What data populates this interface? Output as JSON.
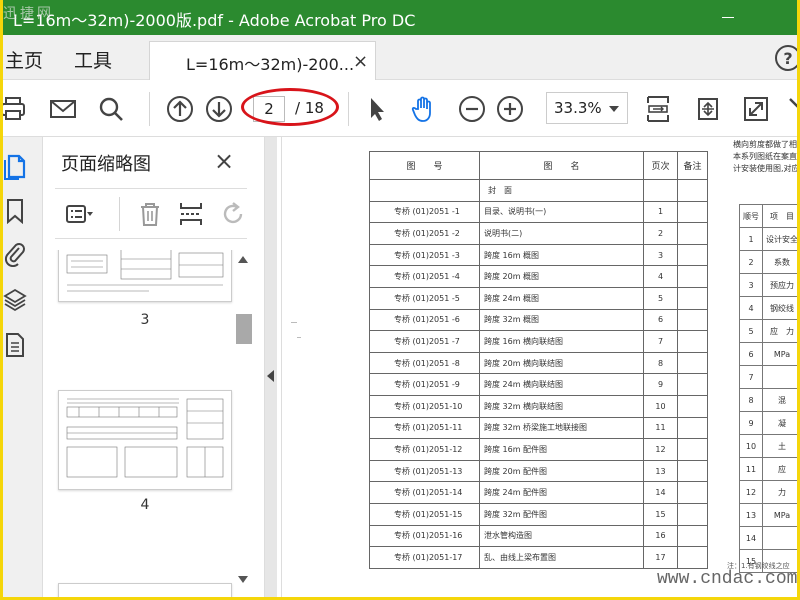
{
  "window": {
    "title": "L=16m～32m)-2000版.pdf - Adobe Acrobat Pro DC",
    "watermark": "迅捷网"
  },
  "menu": {
    "home": "主页",
    "tools": "工具",
    "doc_tab": "L=16m～32m)-200...",
    "doc_tab_close": "×",
    "help": "?"
  },
  "toolbar": {
    "current_page": "2",
    "total_pages": "/ 18",
    "zoom": "33.3%"
  },
  "thumbnails_panel": {
    "title": "页面缩略图",
    "close": "×",
    "pages": [
      {
        "label": "3"
      },
      {
        "label": "4"
      }
    ]
  },
  "document": {
    "table_header": {
      "no": "图　　号",
      "name": "图　　名",
      "pages": "页次",
      "remarks": "备注"
    },
    "rows": [
      {
        "no": "",
        "name": "封　面",
        "page": ""
      },
      {
        "no": "专桥 (01)2051 -1",
        "name": "目录、说明书(一)",
        "page": "1"
      },
      {
        "no": "专桥 (01)2051 -2",
        "name": "说明书(二)",
        "page": "2"
      },
      {
        "no": "专桥 (01)2051 -3",
        "name": "跨度 16m 概图",
        "page": "3"
      },
      {
        "no": "专桥 (01)2051 -4",
        "name": "跨度 20m 概图",
        "page": "4"
      },
      {
        "no": "专桥 (01)2051 -5",
        "name": "跨度 24m 概图",
        "page": "5"
      },
      {
        "no": "专桥 (01)2051 -6",
        "name": "跨度 32m 概图",
        "page": "6"
      },
      {
        "no": "专桥 (01)2051 -7",
        "name": "跨度 16m 横向联结图",
        "page": "7"
      },
      {
        "no": "专桥 (01)2051 -8",
        "name": "跨度 20m 横向联结图",
        "page": "8"
      },
      {
        "no": "专桥 (01)2051 -9",
        "name": "跨度 24m 横向联结图",
        "page": "9"
      },
      {
        "no": "专桥 (01)2051-10",
        "name": "跨度 32m 横向联结图",
        "page": "10"
      },
      {
        "no": "专桥 (01)2051-11",
        "name": "跨度 32m 桥梁施工地联接图",
        "page": "11"
      },
      {
        "no": "专桥 (01)2051-12",
        "name": "跨度 16m 配件图",
        "page": "12"
      },
      {
        "no": "专桥 (01)2051-13",
        "name": "跨度 20m 配件图",
        "page": "13"
      },
      {
        "no": "专桥 (01)2051-14",
        "name": "跨度 24m 配件图",
        "page": "14"
      },
      {
        "no": "专桥 (01)2051-15",
        "name": "跨度 32m 配件图",
        "page": "15"
      },
      {
        "no": "专桥 (01)2051-16",
        "name": "泄水管构造图",
        "page": "16"
      },
      {
        "no": "专桥 (01)2051-17",
        "name": "乱、由线上梁布置图",
        "page": "17"
      }
    ],
    "side_text": [
      "横向剪度都做了相应",
      "本系列图纸在案直上的",
      "计安装使用图,对应的"
    ],
    "side_table": {
      "header": [
        "顺号",
        "项　目"
      ],
      "rows": [
        [
          "1",
          "设计安全"
        ],
        [
          "2",
          "系数"
        ],
        [
          "3",
          "预应力"
        ],
        [
          "4",
          "钢绞线"
        ],
        [
          "5",
          "应　力"
        ],
        [
          "6",
          "MPa"
        ],
        [
          "7",
          ""
        ],
        [
          "8",
          "混"
        ],
        [
          "9",
          "凝"
        ],
        [
          "10",
          "土"
        ],
        [
          "11",
          "应"
        ],
        [
          "12",
          "力"
        ],
        [
          "13",
          "MPa"
        ],
        [
          "14",
          ""
        ],
        [
          "15",
          ""
        ]
      ]
    },
    "foot_note": "注：1.有钢绞线之应",
    "site_watermark": "www.cndac.com"
  }
}
